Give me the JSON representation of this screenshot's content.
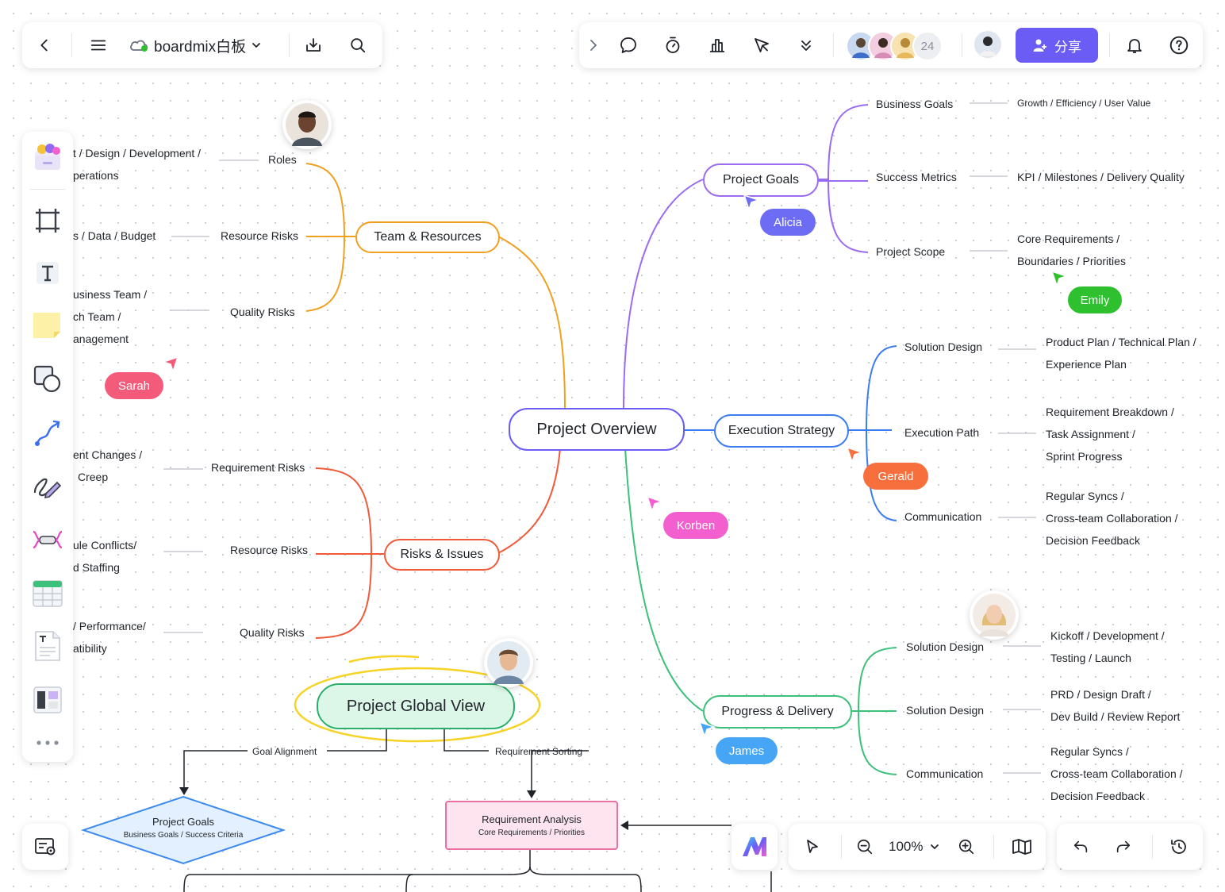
{
  "toolbar_left": {
    "app_name": "boardmix白板",
    "back_icon": "chevron-left-icon",
    "menu_icon": "hamburger-icon",
    "cloud_icon": "cloud-sync-icon",
    "download_icon": "download-icon",
    "search_icon": "search-icon"
  },
  "toolbar_right": {
    "collaborator_count": "24",
    "share_label": "分享"
  },
  "mindmap": {
    "root": "Project Overview",
    "team": {
      "label": "Team & Resources",
      "roles": "Roles",
      "roles_detail_1": "t / Design / Development /",
      "roles_detail_2": "perations",
      "resource_risks": "Resource Risks",
      "resource_detail": "s / Data / Budget",
      "quality_risks": "Quality Risks",
      "quality_detail_1": "usiness Team /",
      "quality_detail_2": "ch Team /",
      "quality_detail_3": "anagement"
    },
    "risks": {
      "label": "Risks & Issues",
      "req_risks": "Requirement Risks",
      "req_detail_1": "ent Changes /",
      "req_detail_2": "Creep",
      "resource_risks": "Resource Risks",
      "resource_detail_1": "ule Conflicts/",
      "resource_detail_2": "d Staffing",
      "quality_risks": "Quality Risks",
      "quality_detail_1": "/ Performance/",
      "quality_detail_2": "atibility"
    },
    "goals": {
      "label": "Project Goals",
      "business_goals": "Business Goals",
      "business_detail": "Growth / Efficiency / User Value",
      "success_metrics": "Success Metrics",
      "success_detail": "KPI / Milestones / Delivery Quality",
      "scope": "Project Scope",
      "scope_detail_1": "Core Requirements /",
      "scope_detail_2": "Boundaries / Priorities"
    },
    "execution": {
      "label": "Execution Strategy",
      "solution": "Solution Design",
      "solution_detail_1": "Product Plan / Technical Plan /",
      "solution_detail_2": "Experience Plan",
      "path": "Execution Path",
      "path_detail_1": "Requirement Breakdown /",
      "path_detail_2": "Task Assignment /",
      "path_detail_3": "Sprint Progress",
      "communication": "Communication",
      "comm_detail_1": "Regular Syncs /",
      "comm_detail_2": "Cross-team Collaboration /",
      "comm_detail_3": "Decision Feedback"
    },
    "progress": {
      "label": "Progress & Delivery",
      "solution_1": "Solution Design",
      "solution_1_detail_1": "Kickoff / Development /",
      "solution_1_detail_2": "Testing / Launch",
      "solution_2": "Solution Design",
      "solution_2_detail_1": "PRD / Design Draft /",
      "solution_2_detail_2": "Dev Build / Review Report",
      "communication": "Communication",
      "comm_detail_1": "Regular Syncs /",
      "comm_detail_2": "Cross-team Collaboration /",
      "comm_detail_3": "Decision Feedback"
    }
  },
  "flowchart": {
    "global_view": "Project Global View",
    "goal_alignment": "Goal Alignment",
    "requirement_sorting": "Requirement Sorting",
    "goals_title": "Project Goals",
    "goals_sub": "Business Goals / Success Criteria",
    "analysis_title": "Requirement Analysis",
    "analysis_sub": "Core Requirements / Priorities"
  },
  "cursors": {
    "alicia": "Alicia",
    "emily": "Emily",
    "sarah": "Sarah",
    "gerald": "Gerald",
    "korben": "Korben",
    "james": "James"
  },
  "colors": {
    "alicia": "#6c6cf5",
    "emily": "#2fc02f",
    "sarah": "#f45b7a",
    "gerald": "#f76f3c",
    "korben": "#f45fd0",
    "james": "#46a6f5",
    "share": "#6b5cf6",
    "team_branch": "#f0a020",
    "risk_branch": "#f05a3a",
    "goals_branch": "#9b6cf0",
    "exec_branch": "#3b7cf0",
    "progress_branch": "#3cc07a"
  },
  "bottom_bar": {
    "zoom": "100%"
  }
}
